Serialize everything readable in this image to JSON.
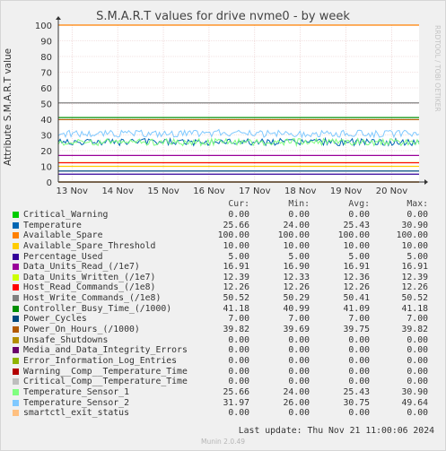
{
  "chart_data": {
    "type": "line",
    "title": "S.M.A.R.T values for drive nvme0 - by week",
    "ylabel": "Attribute S.M.A.R.T value",
    "ylim": [
      0,
      100
    ],
    "yticks": [
      0,
      10,
      20,
      30,
      40,
      50,
      60,
      70,
      80,
      90,
      100
    ],
    "xticks": [
      "13 Nov",
      "14 Nov",
      "15 Nov",
      "16 Nov",
      "17 Nov",
      "18 Nov",
      "19 Nov",
      "20 Nov"
    ],
    "grid": true,
    "legend_columns": [
      "Cur:",
      "Min:",
      "Avg:",
      "Max:"
    ],
    "series": [
      {
        "name": "Critical_Warning",
        "color": "#00cc00",
        "cur": "0.00",
        "min": "0.00",
        "avg": "0.00",
        "max": "0.00",
        "value": 0
      },
      {
        "name": "Temperature",
        "color": "#0066b3",
        "cur": "25.66",
        "min": "24.00",
        "avg": "25.43",
        "max": "30.90",
        "value": 25.43
      },
      {
        "name": "Available_Spare",
        "color": "#ff8000",
        "cur": "100.00",
        "min": "100.00",
        "avg": "100.00",
        "max": "100.00",
        "value": 100
      },
      {
        "name": "Available_Spare_Threshold",
        "color": "#ffcc00",
        "cur": "10.00",
        "min": "10.00",
        "avg": "10.00",
        "max": "10.00",
        "value": 10
      },
      {
        "name": "Percentage_Used",
        "color": "#330099",
        "cur": "5.00",
        "min": "5.00",
        "avg": "5.00",
        "max": "5.00",
        "value": 5
      },
      {
        "name": "Data_Units_Read_(/1e7)",
        "color": "#990099",
        "cur": "16.91",
        "min": "16.90",
        "avg": "16.91",
        "max": "16.91",
        "value": 16.91
      },
      {
        "name": "Data_Units_Written_(/1e7)",
        "color": "#ccff00",
        "cur": "12.39",
        "min": "12.33",
        "avg": "12.36",
        "max": "12.39",
        "value": 12.36
      },
      {
        "name": "Host_Read_Commands_(/1e8)",
        "color": "#ff0000",
        "cur": "12.26",
        "min": "12.26",
        "avg": "12.26",
        "max": "12.26",
        "value": 12.26
      },
      {
        "name": "Host_Write_Commands_(/1e8)",
        "color": "#808080",
        "cur": "50.52",
        "min": "50.29",
        "avg": "50.41",
        "max": "50.52",
        "value": 50.41
      },
      {
        "name": "Controller_Busy_Time_(/1000)",
        "color": "#008f00",
        "cur": "41.18",
        "min": "40.99",
        "avg": "41.09",
        "max": "41.18",
        "value": 41.09
      },
      {
        "name": "Power_Cycles",
        "color": "#00487d",
        "cur": "7.00",
        "min": "7.00",
        "avg": "7.00",
        "max": "7.00",
        "value": 7
      },
      {
        "name": "Power_On_Hours_(/1000)",
        "color": "#b35a00",
        "cur": "39.82",
        "min": "39.69",
        "avg": "39.75",
        "max": "39.82",
        "value": 39.75
      },
      {
        "name": "Unsafe_Shutdowns",
        "color": "#b38f00",
        "cur": "0.00",
        "min": "0.00",
        "avg": "0.00",
        "max": "0.00",
        "value": 0
      },
      {
        "name": "Media_and_Data_Integrity_Errors",
        "color": "#6b006b",
        "cur": "0.00",
        "min": "0.00",
        "avg": "0.00",
        "max": "0.00",
        "value": 0
      },
      {
        "name": "Error_Information_Log_Entries",
        "color": "#8fb300",
        "cur": "0.00",
        "min": "0.00",
        "avg": "0.00",
        "max": "0.00",
        "value": 0
      },
      {
        "name": "Warning__Comp__Temperature_Time",
        "color": "#b30000",
        "cur": "0.00",
        "min": "0.00",
        "avg": "0.00",
        "max": "0.00",
        "value": 0
      },
      {
        "name": "Critical_Comp__Temperature_Time",
        "color": "#bebebe",
        "cur": "0.00",
        "min": "0.00",
        "avg": "0.00",
        "max": "0.00",
        "value": 0
      },
      {
        "name": "Temperature_Sensor_1",
        "color": "#80ff80",
        "cur": "25.66",
        "min": "24.00",
        "avg": "25.43",
        "max": "30.90",
        "value": 25.43
      },
      {
        "name": "Temperature_Sensor_2",
        "color": "#80c9ff",
        "cur": "31.97",
        "min": "26.00",
        "avg": "30.75",
        "max": "49.64",
        "value": 30.75
      },
      {
        "name": "smartctl_exit_status",
        "color": "#ffc080",
        "cur": "0.00",
        "min": "0.00",
        "avg": "0.00",
        "max": "0.00",
        "value": 0
      }
    ]
  },
  "watermark": "RRDTOOL / TOBI OETIKER",
  "footer": "Last update: Thu Nov 21 11:00:06 2024",
  "munin_version": "Munin 2.0.49"
}
